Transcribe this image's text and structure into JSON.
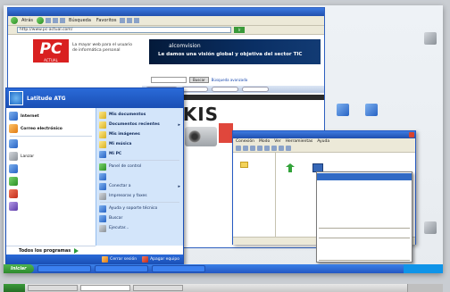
{
  "top_titlebar": {
    "title": ""
  },
  "desktop_icons": [
    {
      "label": ""
    },
    {
      "label": ""
    },
    {
      "label": ""
    },
    {
      "label": ""
    }
  ],
  "browser": {
    "title": "",
    "toolbar": {
      "back": "Atrás",
      "search": "Búsqueda",
      "favorites": "Favoritos"
    },
    "address_label": "",
    "address": "http://www.pc-actual.com/",
    "go": "Ir",
    "page": {
      "logo": "PC",
      "logo_sub": "ACTUAL",
      "tagline": "La mayor web para el usuario de informática personal",
      "banner_brand": "alcomvision",
      "banner_slogan": "Le damos una visión global y objetiva del sector TIC",
      "dateline": "",
      "search_button": "Buscar",
      "search_link": "Búsqueda avanzada",
      "headline": "REEKIS"
    }
  },
  "start_menu": {
    "user": "Latitude ATG",
    "pinned": [
      {
        "title": "Internet",
        "subtitle": ""
      },
      {
        "title": "Correo electrónico",
        "subtitle": ""
      }
    ],
    "recent": [
      {
        "title": ""
      },
      {
        "title": "Lanzar"
      },
      {
        "title": ""
      },
      {
        "title": ""
      },
      {
        "title": ""
      },
      {
        "title": ""
      }
    ],
    "all_programs": "Todos los programas",
    "places": [
      {
        "label": "Mis documentos",
        "bold": true,
        "chevron": false
      },
      {
        "label": "Documentos recientes",
        "bold": true,
        "chevron": true
      },
      {
        "label": "Mis imágenes",
        "bold": true,
        "chevron": false
      },
      {
        "label": "Mi música",
        "bold": true,
        "chevron": false
      },
      {
        "label": "Mi PC",
        "bold": true,
        "chevron": false
      },
      {
        "label": "Panel de control",
        "bold": false,
        "chevron": false
      },
      {
        "label": "",
        "bold": false,
        "chevron": false
      },
      {
        "label": "Conectar a",
        "bold": false,
        "chevron": true
      },
      {
        "label": "Impresoras y faxes",
        "bold": false,
        "chevron": false
      },
      {
        "label": "Ayuda y soporte técnico",
        "bold": false,
        "chevron": false
      },
      {
        "label": "Buscar",
        "bold": false,
        "chevron": false
      },
      {
        "label": "Ejecutar...",
        "bold": false,
        "chevron": false
      }
    ],
    "logoff": "Cerrar sesión",
    "shutdown": "Apagar equipo"
  },
  "explorer": {
    "title": "",
    "menu": [
      "Conexión",
      "Modo",
      "Ver",
      "Herramientas",
      "Ayuda"
    ],
    "tree_node": "",
    "status": ""
  },
  "context_menu": {
    "items": [
      {
        "label": "",
        "shortcut": "",
        "selected": true
      },
      {
        "label": "",
        "shortcut": "",
        "selected": false
      },
      {
        "label": "",
        "shortcut": "",
        "selected": false
      },
      {
        "label": "",
        "shortcut": "",
        "selected": false
      },
      {
        "label": "",
        "shortcut": "",
        "selected": false
      },
      {
        "label": "",
        "shortcut": "",
        "selected": false
      },
      {
        "label": "",
        "shortcut": "",
        "selected": false
      },
      {
        "label": "",
        "shortcut": "",
        "selected": false
      },
      {
        "label": "",
        "shortcut": "",
        "selected": false,
        "sep_before": true
      },
      {
        "label": "",
        "shortcut": "",
        "selected": false,
        "sep_before": true
      },
      {
        "label": "",
        "shortcut": "",
        "selected": false
      },
      {
        "label": "",
        "shortcut": "",
        "selected": false
      },
      {
        "label": "",
        "shortcut": "",
        "selected": false,
        "sep_before": true
      }
    ]
  },
  "taskbar_inner": {
    "start": "Iniciar",
    "tasks": [
      "",
      "",
      ""
    ]
  },
  "taskbar_outer": {
    "tasks": [
      {
        "label": "",
        "active": false
      },
      {
        "label": "",
        "active": true
      },
      {
        "label": "",
        "active": false
      }
    ]
  }
}
